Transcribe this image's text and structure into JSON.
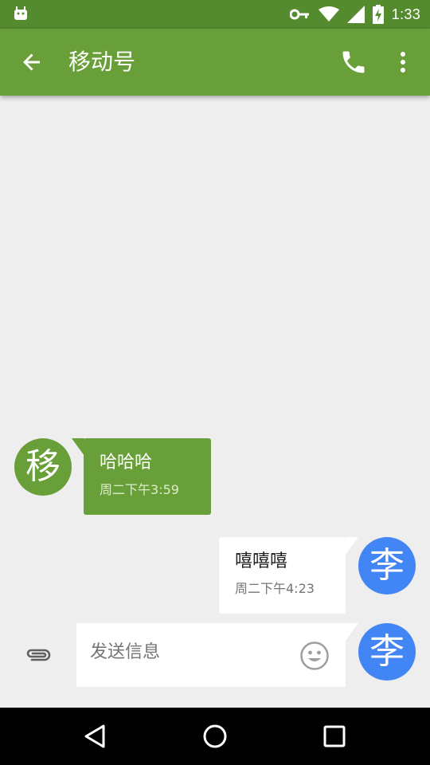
{
  "status_bar": {
    "time": "1:33",
    "icons": [
      "android-debug-icon",
      "key-icon",
      "wifi-icon",
      "signal-icon",
      "battery-charging-icon"
    ]
  },
  "app_bar": {
    "title": "移动号",
    "back_icon": "arrow-back-icon",
    "call_icon": "phone-icon",
    "overflow_icon": "more-vert-icon"
  },
  "messages": [
    {
      "direction": "incoming",
      "avatar_letter": "移",
      "text": "哈哈哈",
      "timestamp": "周二下午3:59"
    },
    {
      "direction": "outgoing",
      "avatar_letter": "李",
      "text": "嘻嘻嘻",
      "timestamp": "周二下午4:23"
    }
  ],
  "compose": {
    "placeholder": "发送信息",
    "avatar_letter": "李",
    "attach_icon": "paperclip-icon",
    "emoji_icon": "smiley-icon"
  },
  "nav_bar": {
    "icons": [
      "back-triangle-icon",
      "home-circle-icon",
      "recents-square-icon"
    ]
  },
  "colors": {
    "status_bar": "#558b2f",
    "app_bar": "#689f38",
    "incoming_bubble": "#689f38",
    "outgoing_avatar": "#4285f4",
    "background": "#eeeeee"
  }
}
